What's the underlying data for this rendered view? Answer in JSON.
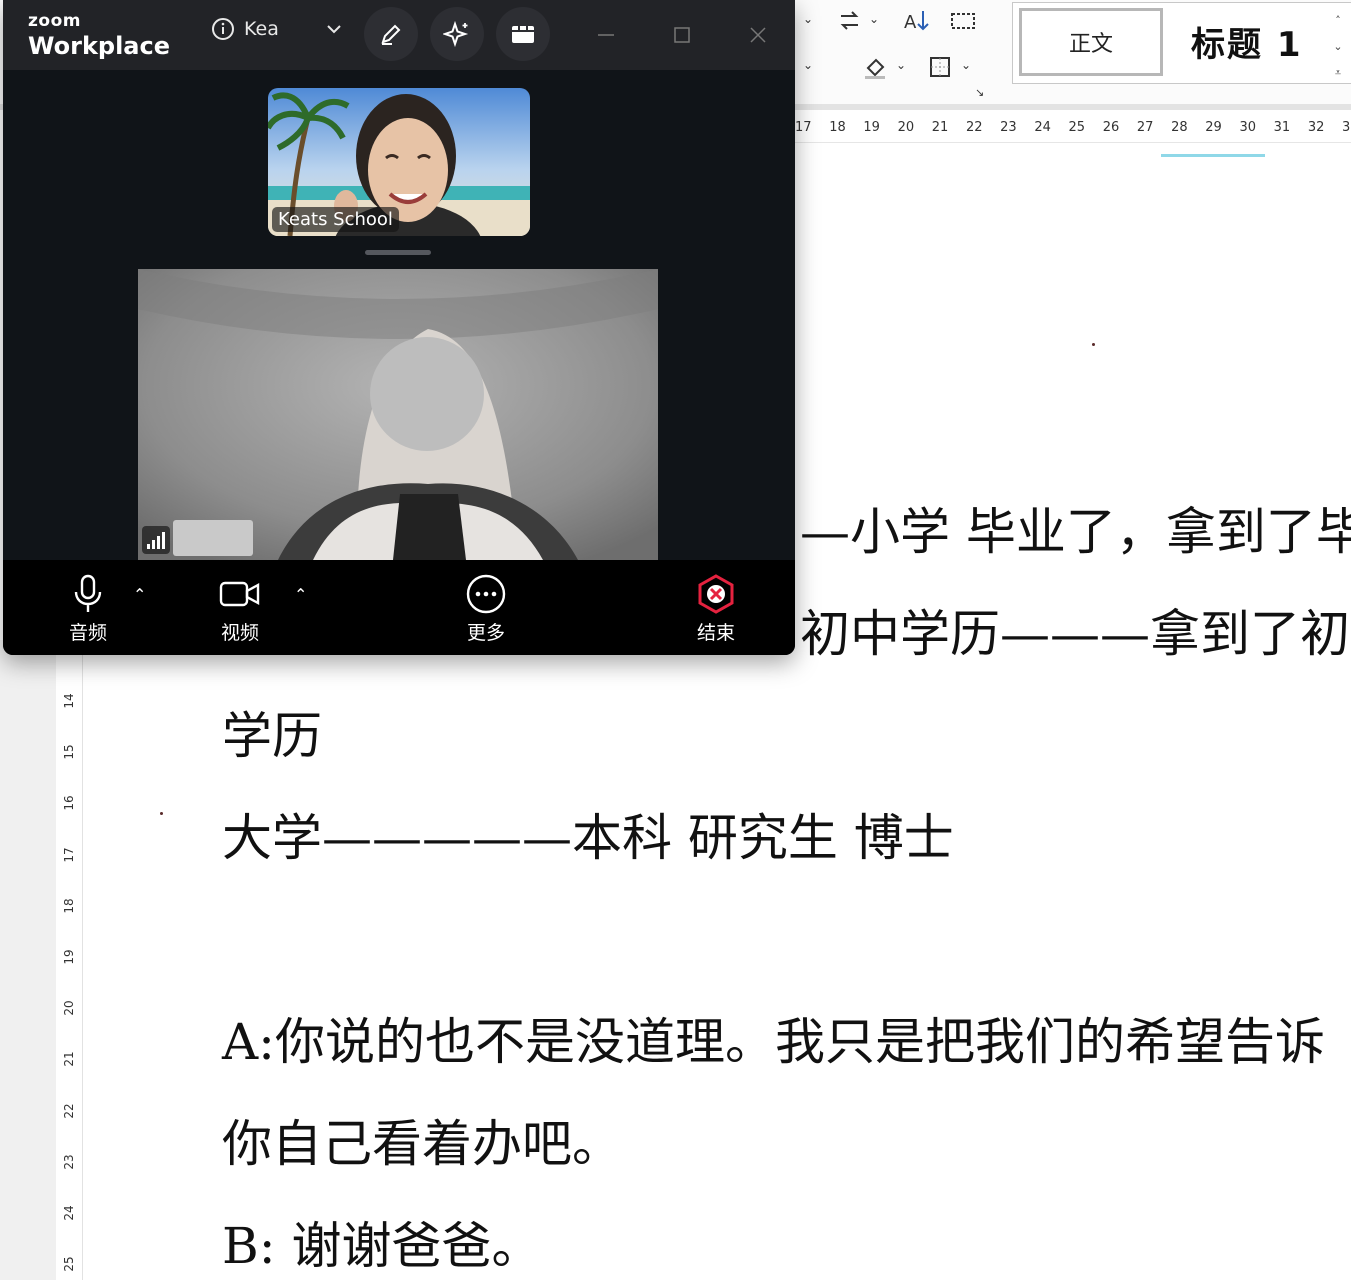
{
  "word": {
    "styles": {
      "normal": "正文",
      "heading1": "标题 1"
    },
    "ruler_numbers": [
      "17",
      "18",
      "19",
      "20",
      "21",
      "22",
      "23",
      "24",
      "25",
      "26",
      "27",
      "28",
      "29",
      "30",
      "31",
      "32",
      "3"
    ],
    "vruler_numbers": [
      "14",
      "15",
      "16",
      "17",
      "18",
      "19",
      "20",
      "21",
      "22",
      "23",
      "24",
      "25"
    ],
    "doc_lines": {
      "line1": "—小学  毕业了，拿到了毕",
      "line2": "初中学历———拿到了初中",
      "line3": "学历",
      "line4": "大学—————本科      研究生     博士",
      "line5": "A:你说的也不是没道理。我只是把我们的希望告诉",
      "line6": "你自己看着办吧。",
      "line7": "B:  谢谢爸爸。"
    }
  },
  "zoom": {
    "brand_small": "zoom",
    "brand_big": "Workplace",
    "meeting_title": "Kea",
    "participant_top": "Keats School",
    "toolbar": {
      "audio": "音频",
      "video": "视频",
      "more": "更多",
      "end": "结束"
    },
    "colors": {
      "end": "#e5223f",
      "window_bg": "#101418",
      "toolbar_bg": "#000000"
    }
  }
}
